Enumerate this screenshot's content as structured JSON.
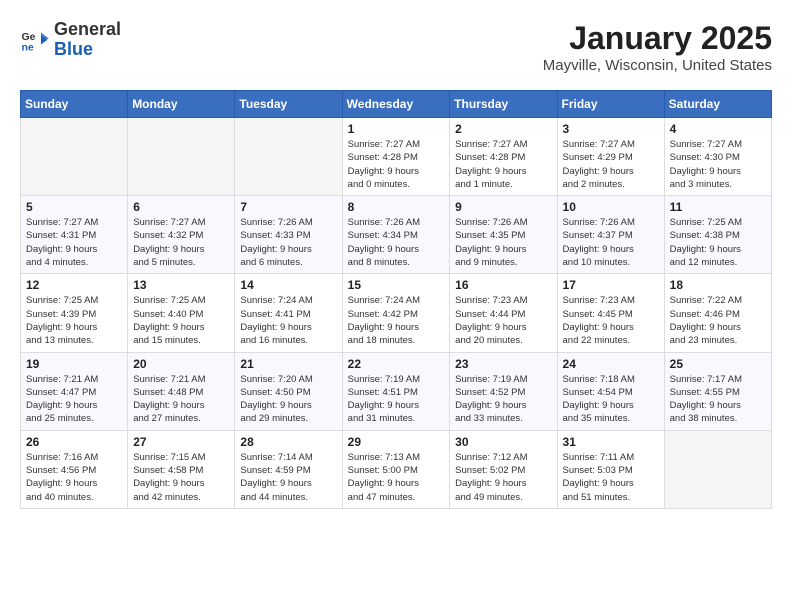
{
  "header": {
    "logo_general": "General",
    "logo_blue": "Blue",
    "month_year": "January 2025",
    "location": "Mayville, Wisconsin, United States"
  },
  "days_of_week": [
    "Sunday",
    "Monday",
    "Tuesday",
    "Wednesday",
    "Thursday",
    "Friday",
    "Saturday"
  ],
  "weeks": [
    [
      {
        "day": "",
        "info": ""
      },
      {
        "day": "",
        "info": ""
      },
      {
        "day": "",
        "info": ""
      },
      {
        "day": "1",
        "info": "Sunrise: 7:27 AM\nSunset: 4:28 PM\nDaylight: 9 hours\nand 0 minutes."
      },
      {
        "day": "2",
        "info": "Sunrise: 7:27 AM\nSunset: 4:28 PM\nDaylight: 9 hours\nand 1 minute."
      },
      {
        "day": "3",
        "info": "Sunrise: 7:27 AM\nSunset: 4:29 PM\nDaylight: 9 hours\nand 2 minutes."
      },
      {
        "day": "4",
        "info": "Sunrise: 7:27 AM\nSunset: 4:30 PM\nDaylight: 9 hours\nand 3 minutes."
      }
    ],
    [
      {
        "day": "5",
        "info": "Sunrise: 7:27 AM\nSunset: 4:31 PM\nDaylight: 9 hours\nand 4 minutes."
      },
      {
        "day": "6",
        "info": "Sunrise: 7:27 AM\nSunset: 4:32 PM\nDaylight: 9 hours\nand 5 minutes."
      },
      {
        "day": "7",
        "info": "Sunrise: 7:26 AM\nSunset: 4:33 PM\nDaylight: 9 hours\nand 6 minutes."
      },
      {
        "day": "8",
        "info": "Sunrise: 7:26 AM\nSunset: 4:34 PM\nDaylight: 9 hours\nand 8 minutes."
      },
      {
        "day": "9",
        "info": "Sunrise: 7:26 AM\nSunset: 4:35 PM\nDaylight: 9 hours\nand 9 minutes."
      },
      {
        "day": "10",
        "info": "Sunrise: 7:26 AM\nSunset: 4:37 PM\nDaylight: 9 hours\nand 10 minutes."
      },
      {
        "day": "11",
        "info": "Sunrise: 7:25 AM\nSunset: 4:38 PM\nDaylight: 9 hours\nand 12 minutes."
      }
    ],
    [
      {
        "day": "12",
        "info": "Sunrise: 7:25 AM\nSunset: 4:39 PM\nDaylight: 9 hours\nand 13 minutes."
      },
      {
        "day": "13",
        "info": "Sunrise: 7:25 AM\nSunset: 4:40 PM\nDaylight: 9 hours\nand 15 minutes."
      },
      {
        "day": "14",
        "info": "Sunrise: 7:24 AM\nSunset: 4:41 PM\nDaylight: 9 hours\nand 16 minutes."
      },
      {
        "day": "15",
        "info": "Sunrise: 7:24 AM\nSunset: 4:42 PM\nDaylight: 9 hours\nand 18 minutes."
      },
      {
        "day": "16",
        "info": "Sunrise: 7:23 AM\nSunset: 4:44 PM\nDaylight: 9 hours\nand 20 minutes."
      },
      {
        "day": "17",
        "info": "Sunrise: 7:23 AM\nSunset: 4:45 PM\nDaylight: 9 hours\nand 22 minutes."
      },
      {
        "day": "18",
        "info": "Sunrise: 7:22 AM\nSunset: 4:46 PM\nDaylight: 9 hours\nand 23 minutes."
      }
    ],
    [
      {
        "day": "19",
        "info": "Sunrise: 7:21 AM\nSunset: 4:47 PM\nDaylight: 9 hours\nand 25 minutes."
      },
      {
        "day": "20",
        "info": "Sunrise: 7:21 AM\nSunset: 4:48 PM\nDaylight: 9 hours\nand 27 minutes."
      },
      {
        "day": "21",
        "info": "Sunrise: 7:20 AM\nSunset: 4:50 PM\nDaylight: 9 hours\nand 29 minutes."
      },
      {
        "day": "22",
        "info": "Sunrise: 7:19 AM\nSunset: 4:51 PM\nDaylight: 9 hours\nand 31 minutes."
      },
      {
        "day": "23",
        "info": "Sunrise: 7:19 AM\nSunset: 4:52 PM\nDaylight: 9 hours\nand 33 minutes."
      },
      {
        "day": "24",
        "info": "Sunrise: 7:18 AM\nSunset: 4:54 PM\nDaylight: 9 hours\nand 35 minutes."
      },
      {
        "day": "25",
        "info": "Sunrise: 7:17 AM\nSunset: 4:55 PM\nDaylight: 9 hours\nand 38 minutes."
      }
    ],
    [
      {
        "day": "26",
        "info": "Sunrise: 7:16 AM\nSunset: 4:56 PM\nDaylight: 9 hours\nand 40 minutes."
      },
      {
        "day": "27",
        "info": "Sunrise: 7:15 AM\nSunset: 4:58 PM\nDaylight: 9 hours\nand 42 minutes."
      },
      {
        "day": "28",
        "info": "Sunrise: 7:14 AM\nSunset: 4:59 PM\nDaylight: 9 hours\nand 44 minutes."
      },
      {
        "day": "29",
        "info": "Sunrise: 7:13 AM\nSunset: 5:00 PM\nDaylight: 9 hours\nand 47 minutes."
      },
      {
        "day": "30",
        "info": "Sunrise: 7:12 AM\nSunset: 5:02 PM\nDaylight: 9 hours\nand 49 minutes."
      },
      {
        "day": "31",
        "info": "Sunrise: 7:11 AM\nSunset: 5:03 PM\nDaylight: 9 hours\nand 51 minutes."
      },
      {
        "day": "",
        "info": ""
      }
    ]
  ]
}
